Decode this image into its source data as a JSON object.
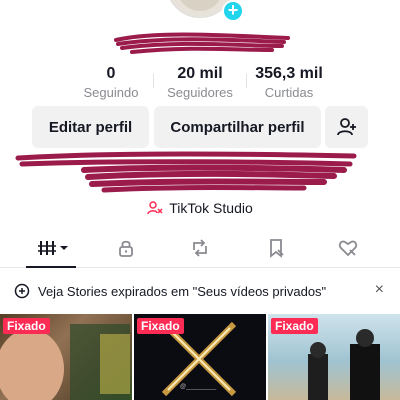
{
  "profile": {
    "stats": [
      {
        "value": "0",
        "label": "Seguindo"
      },
      {
        "value": "20 mil",
        "label": "Seguidores"
      },
      {
        "value": "356,3 mil",
        "label": "Curtidas"
      }
    ],
    "edit_label": "Editar perfil",
    "share_label": "Compartilhar perfil",
    "studio_label": "TikTok Studio"
  },
  "banner": {
    "text": "Veja Stories expirados em \"Seus vídeos privados\"",
    "close": "×"
  },
  "grid": {
    "pinned_label": "Fixado",
    "watermark": "@_________"
  },
  "colors": {
    "accent": "#fe2c55",
    "plus": "#20d5ec",
    "scribble": "#9b1b4a"
  },
  "icons": [
    "plus-icon",
    "add-friend-icon",
    "studio-icon",
    "grid-icon",
    "lock-icon",
    "repost-icon",
    "favorites-icon",
    "liked-icon",
    "story-icon"
  ]
}
